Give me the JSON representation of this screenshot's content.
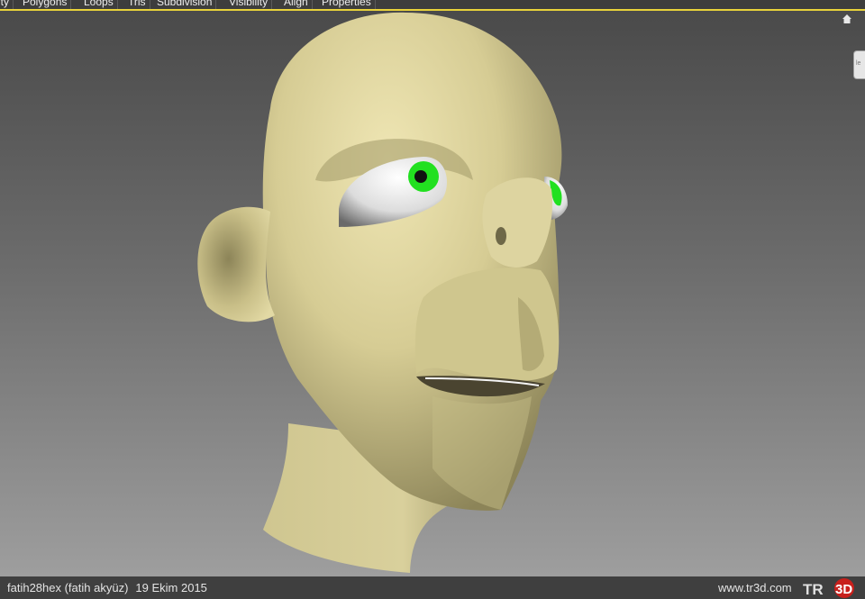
{
  "menubar": {
    "tabs": [
      "ity",
      "Polygons",
      "Loops",
      "Tris",
      "Subdivision",
      "Visibility",
      "Align",
      "Properties"
    ]
  },
  "viewport": {
    "viewcube_label": "le",
    "colors": {
      "skin": "#d8cf98",
      "iris": "#22e020",
      "highlight": "#e8d23a"
    }
  },
  "footer": {
    "author": "fatih28hex (fatih akyüz)",
    "date": "19 Ekim 2015",
    "site": "www.tr3d.com",
    "logo": "TR3D"
  }
}
